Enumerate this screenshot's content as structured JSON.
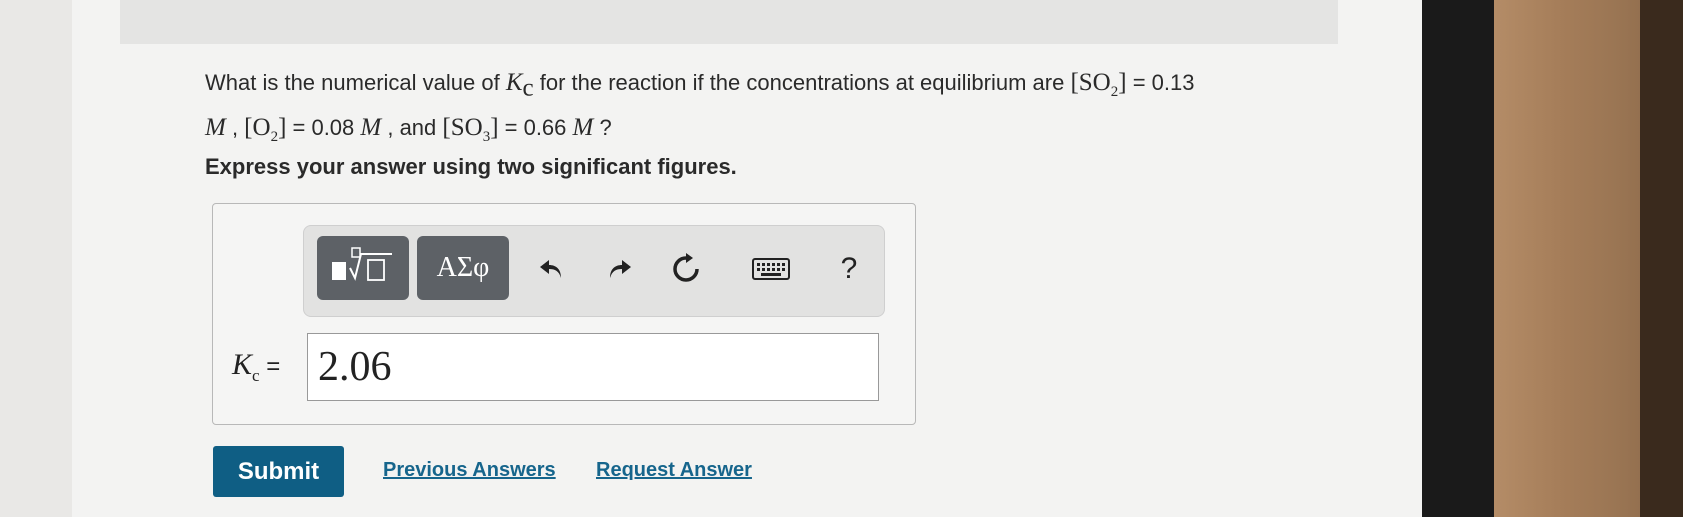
{
  "question": {
    "text_before": "What is the numerical value of ",
    "kc_symbol": "K",
    "kc_subscript": "c",
    "text_middle": " for the reaction if the concentrations at equilibrium are ",
    "so2_species": "SO",
    "so2_sub": "2",
    "so2_value": " = 0.13",
    "unit_M": "M",
    "sep1": " , ",
    "o2_species": "O",
    "o2_sub": "2",
    "o2_value": " = 0.08 ",
    "sep2": " , and ",
    "so3_species": "SO",
    "so3_sub": "3",
    "so3_value": " = 0.66 ",
    "end": " ?"
  },
  "instruction": "Express your answer using two significant figures.",
  "toolbar": {
    "greek_label": "ΑΣφ",
    "help_label": "?"
  },
  "answer": {
    "label_symbol": "K",
    "label_sub": "c",
    "label_equals": " =",
    "value": "2.06"
  },
  "actions": {
    "submit_label": "Submit",
    "previous_answers_label": "Previous Answers",
    "request_answer_label": "Request Answer"
  },
  "colors": {
    "submit_bg": "#0f5e84",
    "link": "#16658c",
    "toolbar_button": "#5d6166"
  },
  "icons": [
    "templates-icon",
    "undo-icon",
    "redo-icon",
    "reset-icon",
    "keyboard-icon",
    "help-icon"
  ]
}
